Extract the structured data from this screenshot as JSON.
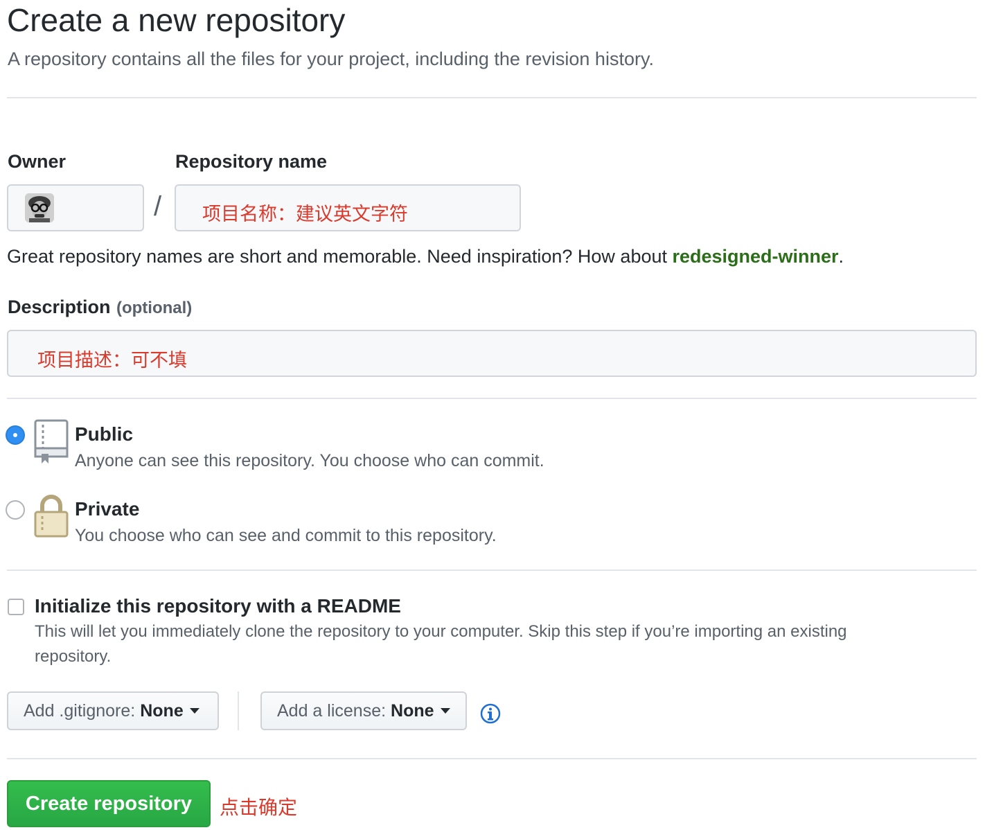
{
  "header": {
    "title": "Create a new repository",
    "subtitle": "A repository contains all the files for your project, including the revision history."
  },
  "owner": {
    "label": "Owner"
  },
  "separator": "/",
  "repo_name": {
    "label": "Repository name",
    "hint": "项目名称：建议英文字符"
  },
  "name_tip": {
    "prefix": "Great repository names are short and memorable. Need inspiration? How about ",
    "suggestion": "redesigned-winner",
    "suffix": "."
  },
  "description": {
    "label": "Description",
    "optional": "(optional)",
    "hint": "项目描述：可不填"
  },
  "visibility": {
    "public": {
      "title": "Public",
      "desc": "Anyone can see this repository. You choose who can commit.",
      "selected": true,
      "icon": "repo-book-icon"
    },
    "private": {
      "title": "Private",
      "desc": "You choose who can see and commit to this repository.",
      "selected": false,
      "icon": "lock-icon"
    }
  },
  "readme": {
    "title": "Initialize this repository with a README",
    "desc_line1": "This will let you immediately clone the repository to your computer. Skip this step if you’re importing an existing",
    "desc_line2": "repository.",
    "checked": false
  },
  "gitignore": {
    "prefix": "Add .gitignore:",
    "value": "None"
  },
  "license": {
    "prefix": "Add a license:",
    "value": "None"
  },
  "create_button": {
    "label": "Create repository"
  },
  "create_hint": "点击确定",
  "colors": {
    "primary_green": "#28a745",
    "accent_blue": "#2f8ff2",
    "annotation_red": "#d93a2c",
    "link_green": "#2b6d18"
  }
}
